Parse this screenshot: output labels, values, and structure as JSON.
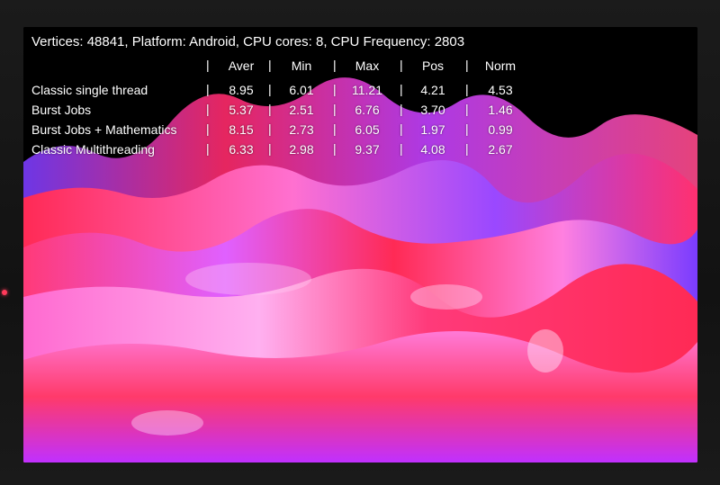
{
  "header": {
    "text": "Vertices: 48841, Platform: Android, CPU cores: 8, CPU Frequency: 2803"
  },
  "table": {
    "columns": [
      "Aver",
      "Min",
      "Max",
      "Pos",
      "Norm"
    ],
    "rows": [
      {
        "label": "Classic single thread",
        "values": [
          "8.95",
          "6.01",
          "11.21",
          "4.21",
          "4.53"
        ]
      },
      {
        "label": "Burst Jobs",
        "values": [
          "5.37",
          "2.51",
          "6.76",
          "3.70",
          "1.46"
        ]
      },
      {
        "label": "Burst Jobs + Mathematics",
        "values": [
          "8.15",
          "2.73",
          "6.05",
          "1.97",
          "0.99"
        ]
      },
      {
        "label": "Classic Multithreading",
        "values": [
          "6.33",
          "2.98",
          "9.37",
          "4.08",
          "2.67"
        ]
      }
    ]
  },
  "colors": {
    "terrain_red": "#ff2a55",
    "terrain_pink": "#ff7ad8",
    "terrain_purple": "#7a3cff",
    "indicator": "#ff3a5a"
  }
}
